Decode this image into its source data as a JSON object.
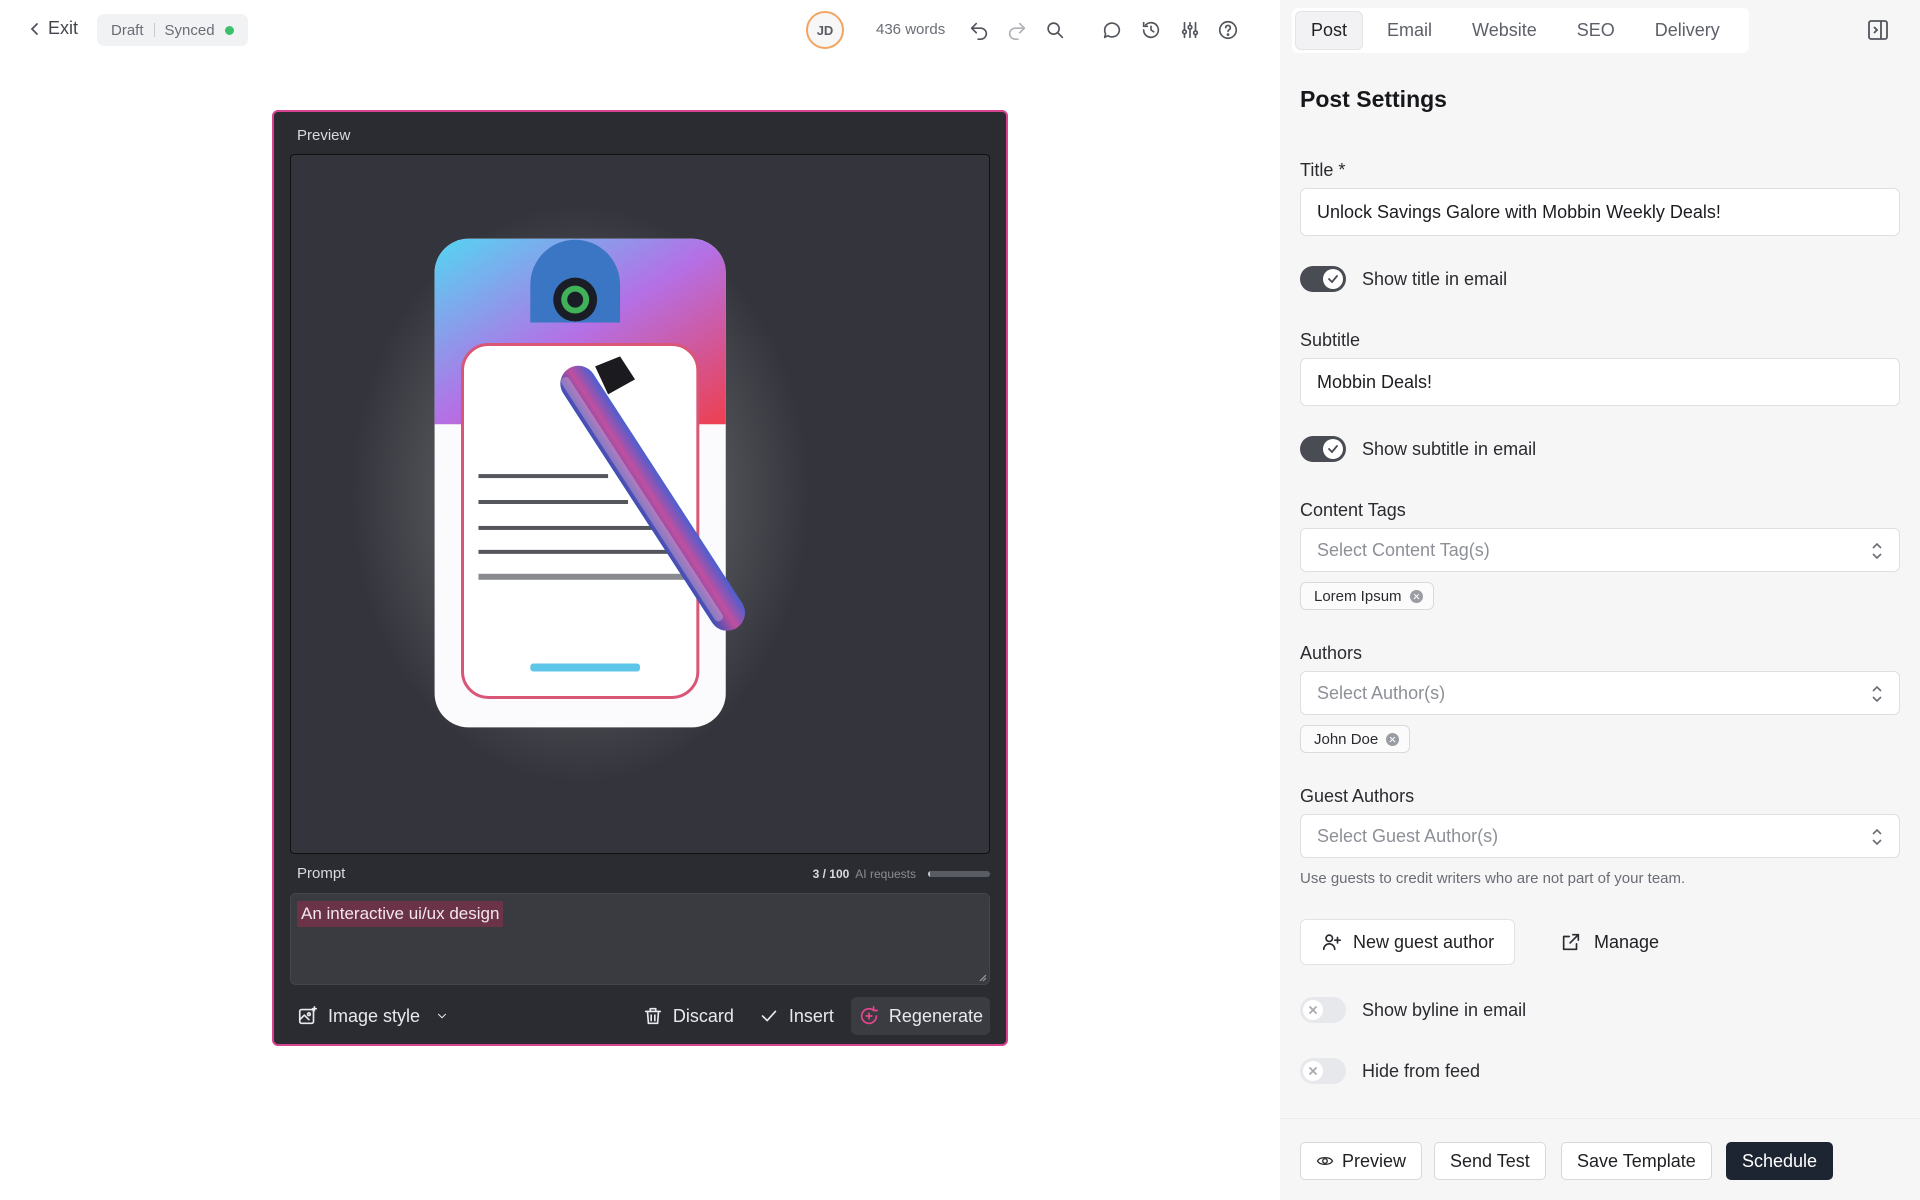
{
  "topbar": {
    "exit_label": "Exit",
    "status_draft": "Draft",
    "status_synced": "Synced",
    "avatar_initials": "JD",
    "word_count": "436 words"
  },
  "preview": {
    "card_label": "Preview",
    "prompt_label": "Prompt",
    "ai_requests_count": "3 / 100",
    "ai_requests_label": "AI requests",
    "ai_requests_used_fraction": 0.03,
    "prompt_text": "An interactive ui/ux design",
    "image_style_label": "Image style",
    "discard_label": "Discard",
    "insert_label": "Insert",
    "regenerate_label": "Regenerate"
  },
  "panel": {
    "tabs": [
      {
        "label": "Post",
        "active": true
      },
      {
        "label": "Email",
        "active": false
      },
      {
        "label": "Website",
        "active": false
      },
      {
        "label": "SEO",
        "active": false
      },
      {
        "label": "Delivery",
        "active": false
      }
    ],
    "heading": "Post Settings",
    "title_label": "Title *",
    "title_value": "Unlock Savings Galore with Mobbin Weekly Deals!",
    "show_title_label": "Show title in email",
    "show_title_on": true,
    "subtitle_label": "Subtitle",
    "subtitle_value": "Mobbin Deals!",
    "show_subtitle_label": "Show subtitle in email",
    "show_subtitle_on": true,
    "content_tags_label": "Content Tags",
    "content_tags_placeholder": "Select Content Tag(s)",
    "content_tag_chip": "Lorem Ipsum",
    "authors_label": "Authors",
    "authors_placeholder": "Select Author(s)",
    "author_chip": "John Doe",
    "guest_authors_label": "Guest Authors",
    "guest_authors_placeholder": "Select Guest Author(s)",
    "guest_hint": "Use guests to credit writers who are not part of your team.",
    "new_guest_label": "New guest author",
    "manage_label": "Manage",
    "show_byline_label": "Show byline in email",
    "show_byline_on": false,
    "hide_feed_label": "Hide from feed",
    "hide_feed_on": false
  },
  "footer": {
    "preview_label": "Preview",
    "send_test_label": "Send Test",
    "save_template_label": "Save Template",
    "schedule_label": "Schedule"
  },
  "colors": {
    "accent_pink": "#d7438f",
    "primary_dark": "#1e2532",
    "synced_green": "#3ec06a"
  }
}
